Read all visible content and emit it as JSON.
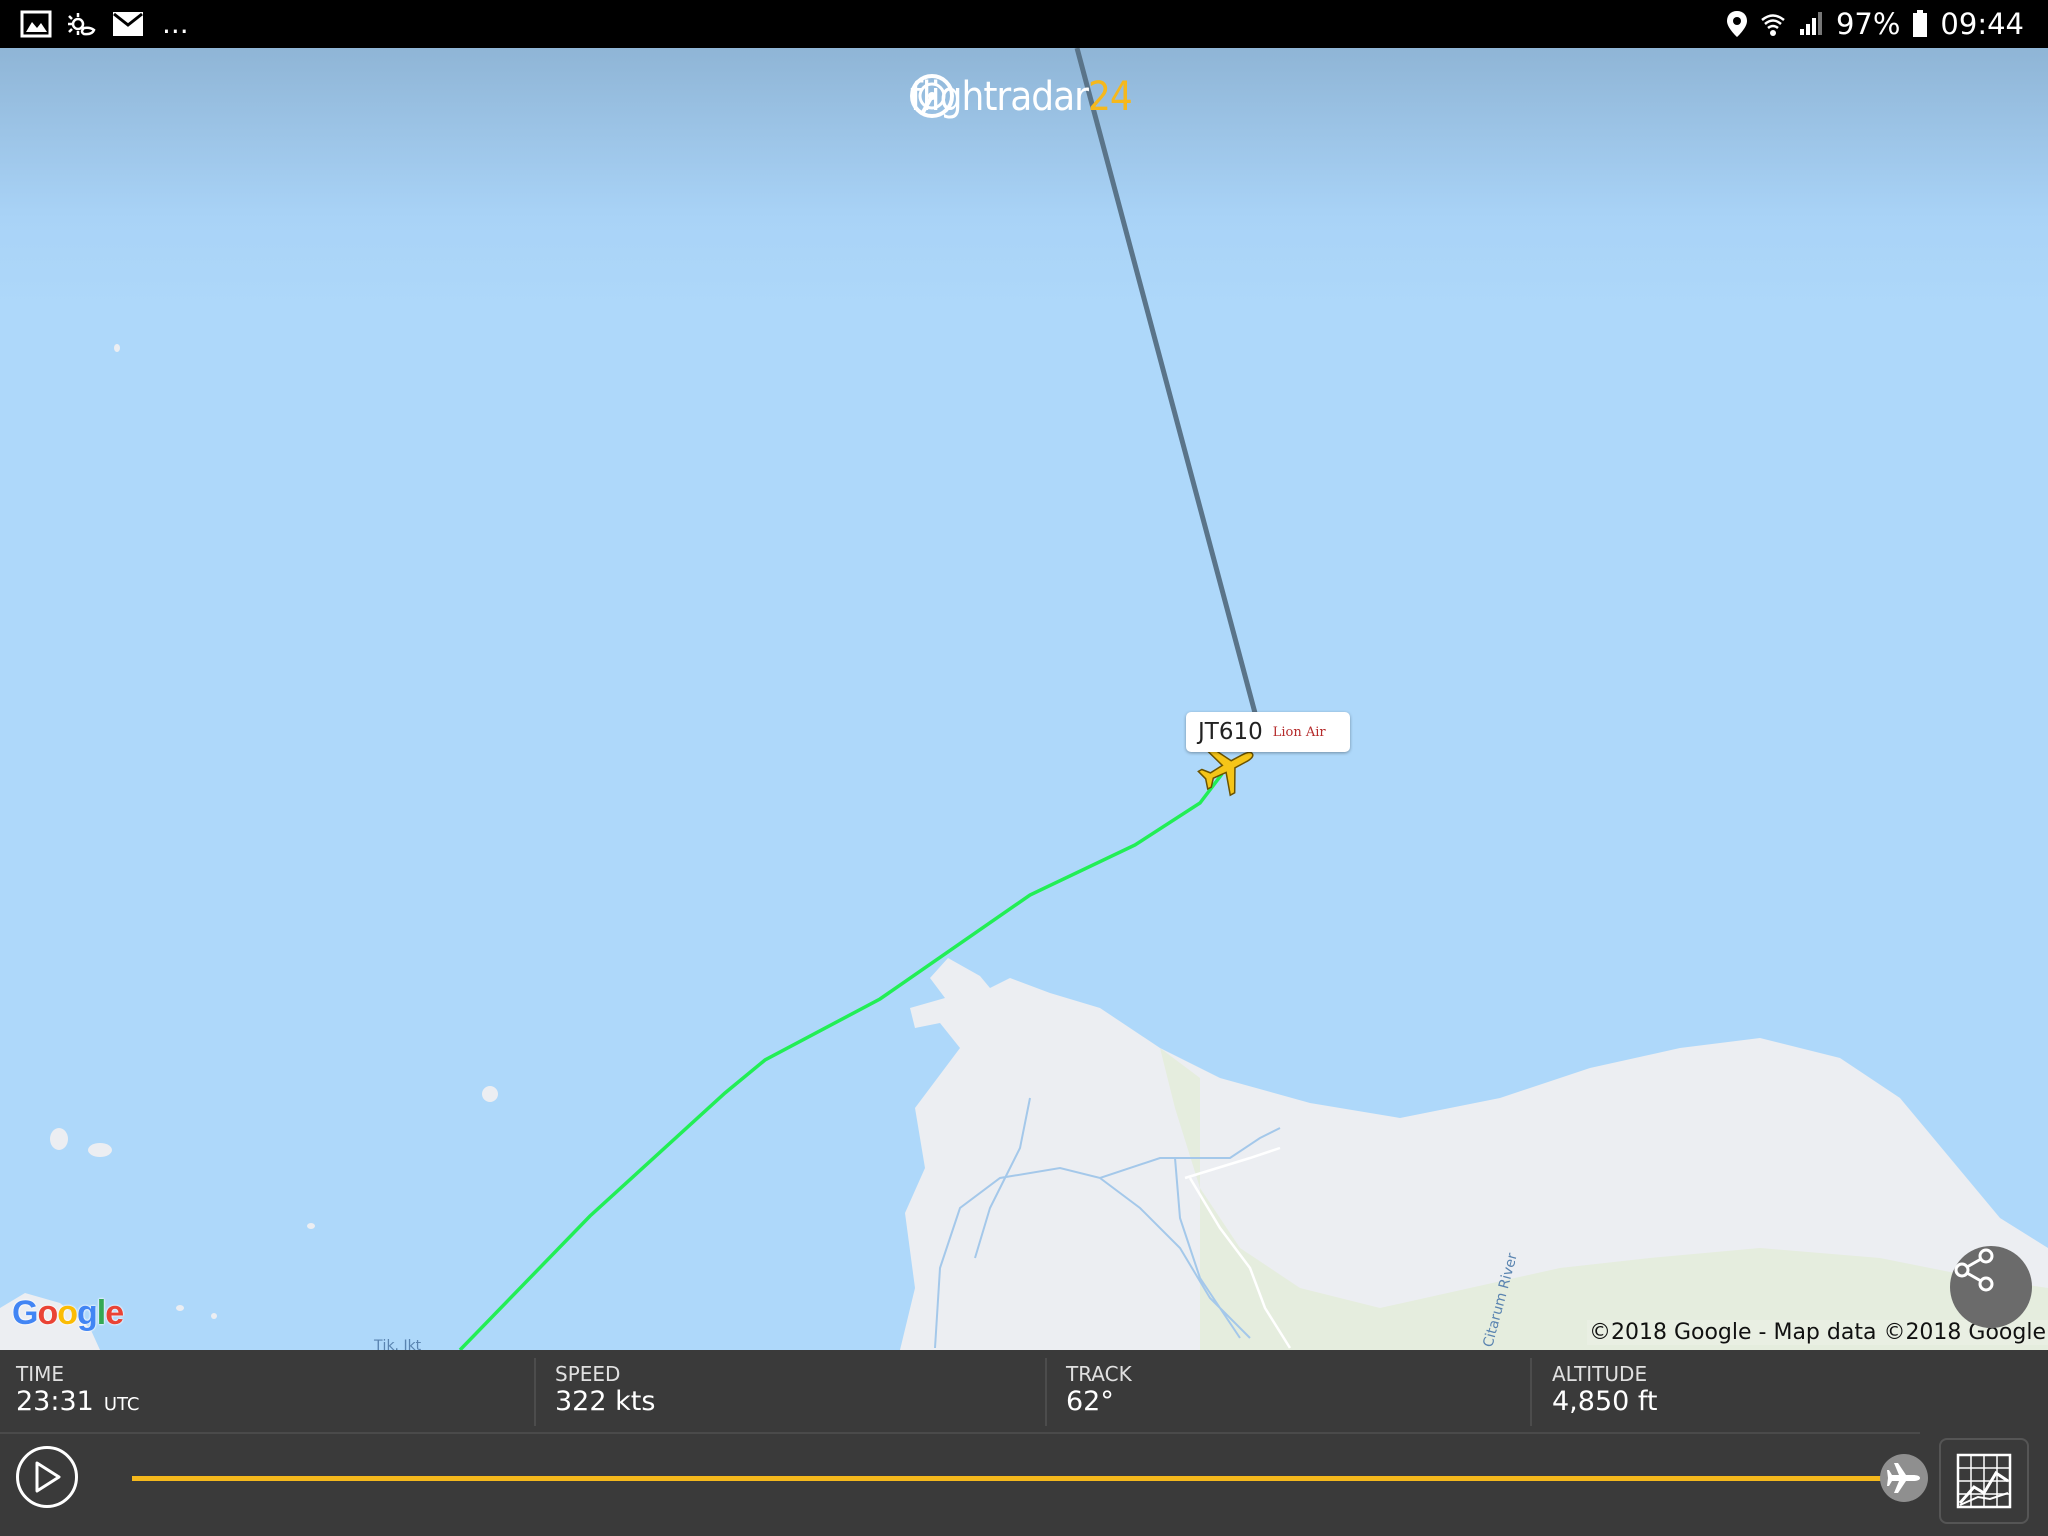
{
  "status_bar": {
    "left_icons": [
      "gallery-icon",
      "weather-icon",
      "email-icon"
    ],
    "more": "...",
    "battery": "97%",
    "time": "09:44",
    "right_icons": [
      "location-icon",
      "wifi-icon",
      "signal-icon",
      "battery-icon"
    ]
  },
  "map": {
    "brand_text": "flightradar",
    "brand_number": "24",
    "flight_code": "JT610",
    "airline": "Lion Air",
    "google_logo": "Google",
    "attribution": "©2018 Google - Map data ©2018 Google",
    "place_labels": [
      "Tjk. Jkt",
      "Citarum River"
    ],
    "colors": {
      "water": "#aed8fa",
      "land": "#eceef2",
      "green_land": "#e4ecdc",
      "flight_track": "#22ee55",
      "planned_route": "#5a7489",
      "plane": "#f5c518"
    }
  },
  "panel": {
    "time_label": "TIME",
    "time_value": "23:31",
    "time_unit": "UTC",
    "speed_label": "SPEED",
    "speed_value": "322 kts",
    "track_label": "TRACK",
    "track_value": "62°",
    "altitude_label": "ALTITUDE",
    "altitude_value": "4,850 ft",
    "playback_progress": 1.0,
    "accent_color": "#f5b81c"
  }
}
